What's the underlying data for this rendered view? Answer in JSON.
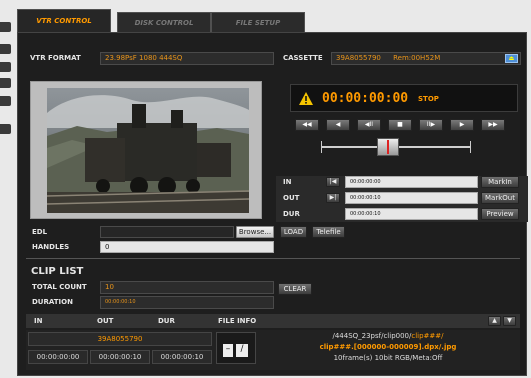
{
  "tabs": [
    {
      "label": "VTR CONTROL",
      "active": true
    },
    {
      "label": "DISK CONTROL",
      "active": false
    },
    {
      "label": "FILE SETUP",
      "active": false
    }
  ],
  "vtr": {
    "format_label": "VTR FORMAT",
    "format_value": "23.98PsF 1080 444SQ",
    "cassette_label": "CASSETTE",
    "cassette_id": "39A8055790",
    "remaining": "Rem:00H52M",
    "timecode": "00:00:00:00",
    "status": "STOP",
    "transport_buttons": [
      {
        "name": "rewind",
        "glyph": "◀◀"
      },
      {
        "name": "step-back",
        "glyph": "◀"
      },
      {
        "name": "frame-back",
        "glyph": "◀II"
      },
      {
        "name": "stop",
        "glyph": "■"
      },
      {
        "name": "frame-forward",
        "glyph": "II▶"
      },
      {
        "name": "play",
        "glyph": "▶"
      },
      {
        "name": "fast-forward",
        "glyph": "▶▶"
      }
    ],
    "in_label": "IN",
    "in_value": "00:00:00:00",
    "out_label": "OUT",
    "out_value": "00:00:00:10",
    "dur_label": "DUR",
    "dur_value": "00:00:00:10",
    "markin": "MarkIn",
    "markout": "MarkOut",
    "preview": "Preview"
  },
  "edl": {
    "label": "EDL",
    "value": "",
    "browse": "Browse...",
    "load": "LOAD",
    "telefile": "Telefile",
    "handles_label": "HANDLES",
    "handles_value": "0"
  },
  "clip_list": {
    "title": "CLIP LIST",
    "total_count_label": "TOTAL COUNT",
    "total_count": "10",
    "duration_label": "DURATION",
    "duration": "00:00:00:10",
    "clear": "CLEAR",
    "columns": [
      "IN",
      "OUT",
      "DUR",
      "FILE INFO"
    ],
    "row": {
      "cassette": "39A8055790",
      "in": "00:00:00:00",
      "out": "00:00:00:10",
      "dur": "00:00:00:10",
      "path_prefix": "/444SQ_23psf/clip000/",
      "path_pattern": "clip###/",
      "file_pattern": "clip###.[000000-000009].dpx/.jpg",
      "meta": "10frame(s) 10bit RGB/Meta:Off"
    }
  },
  "colors": {
    "accent": "#ff9a00",
    "panel_bg": "#1e1e1e",
    "warning": "#f5c400"
  }
}
